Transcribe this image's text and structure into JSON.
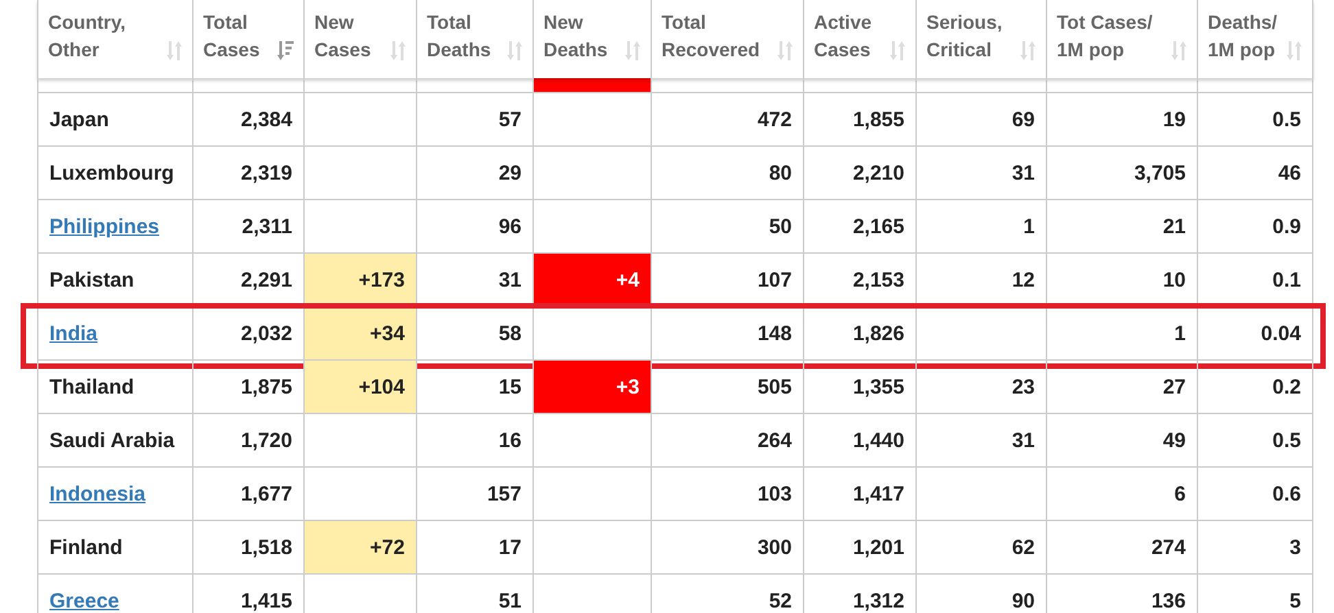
{
  "columns": [
    {
      "label": "Country, Other",
      "sorted": false
    },
    {
      "label": "Total Cases",
      "sorted": true
    },
    {
      "label": "New Cases",
      "sorted": false
    },
    {
      "label": "Total Deaths",
      "sorted": false
    },
    {
      "label": "New Deaths",
      "sorted": false
    },
    {
      "label": "Total Recovered",
      "sorted": false
    },
    {
      "label": "Active Cases",
      "sorted": false
    },
    {
      "label": "Serious, Critical",
      "sorted": false
    },
    {
      "label": "Tot Cases/ 1M pop",
      "sorted": false
    },
    {
      "label": "Deaths/ 1M pop",
      "sorted": false
    }
  ],
  "clipped_row": {
    "new_deaths_marked": true
  },
  "rows": [
    {
      "country": "Japan",
      "link": false,
      "highlighted": false,
      "total_cases": "2,384",
      "new_cases": "",
      "total_deaths": "57",
      "new_deaths": "",
      "total_recovered": "472",
      "active_cases": "1,855",
      "serious_critical": "69",
      "tot_cases_per_1m": "19",
      "deaths_per_1m": "0.5"
    },
    {
      "country": "Luxembourg",
      "link": false,
      "highlighted": false,
      "total_cases": "2,319",
      "new_cases": "",
      "total_deaths": "29",
      "new_deaths": "",
      "total_recovered": "80",
      "active_cases": "2,210",
      "serious_critical": "31",
      "tot_cases_per_1m": "3,705",
      "deaths_per_1m": "46"
    },
    {
      "country": "Philippines",
      "link": true,
      "highlighted": false,
      "total_cases": "2,311",
      "new_cases": "",
      "total_deaths": "96",
      "new_deaths": "",
      "total_recovered": "50",
      "active_cases": "2,165",
      "serious_critical": "1",
      "tot_cases_per_1m": "21",
      "deaths_per_1m": "0.9"
    },
    {
      "country": "Pakistan",
      "link": false,
      "highlighted": false,
      "total_cases": "2,291",
      "new_cases": "+173",
      "total_deaths": "31",
      "new_deaths": "+4",
      "total_recovered": "107",
      "active_cases": "2,153",
      "serious_critical": "12",
      "tot_cases_per_1m": "10",
      "deaths_per_1m": "0.1"
    },
    {
      "country": "India",
      "link": true,
      "highlighted": true,
      "total_cases": "2,032",
      "new_cases": "+34",
      "total_deaths": "58",
      "new_deaths": "",
      "total_recovered": "148",
      "active_cases": "1,826",
      "serious_critical": "",
      "tot_cases_per_1m": "1",
      "deaths_per_1m": "0.04"
    },
    {
      "country": "Thailand",
      "link": false,
      "highlighted": false,
      "total_cases": "1,875",
      "new_cases": "+104",
      "total_deaths": "15",
      "new_deaths": "+3",
      "total_recovered": "505",
      "active_cases": "1,355",
      "serious_critical": "23",
      "tot_cases_per_1m": "27",
      "deaths_per_1m": "0.2"
    },
    {
      "country": "Saudi Arabia",
      "link": false,
      "highlighted": false,
      "total_cases": "1,720",
      "new_cases": "",
      "total_deaths": "16",
      "new_deaths": "",
      "total_recovered": "264",
      "active_cases": "1,440",
      "serious_critical": "31",
      "tot_cases_per_1m": "49",
      "deaths_per_1m": "0.5"
    },
    {
      "country": "Indonesia",
      "link": true,
      "highlighted": false,
      "total_cases": "1,677",
      "new_cases": "",
      "total_deaths": "157",
      "new_deaths": "",
      "total_recovered": "103",
      "active_cases": "1,417",
      "serious_critical": "",
      "tot_cases_per_1m": "6",
      "deaths_per_1m": "0.6"
    },
    {
      "country": "Finland",
      "link": false,
      "highlighted": false,
      "total_cases": "1,518",
      "new_cases": "+72",
      "total_deaths": "17",
      "new_deaths": "",
      "total_recovered": "300",
      "active_cases": "1,201",
      "serious_critical": "62",
      "tot_cases_per_1m": "274",
      "deaths_per_1m": "3"
    },
    {
      "country": "Greece",
      "link": true,
      "highlighted": false,
      "total_cases": "1,415",
      "new_cases": "",
      "total_deaths": "51",
      "new_deaths": "",
      "total_recovered": "52",
      "active_cases": "1,312",
      "serious_critical": "90",
      "tot_cases_per_1m": "136",
      "deaths_per_1m": "5"
    }
  ]
}
